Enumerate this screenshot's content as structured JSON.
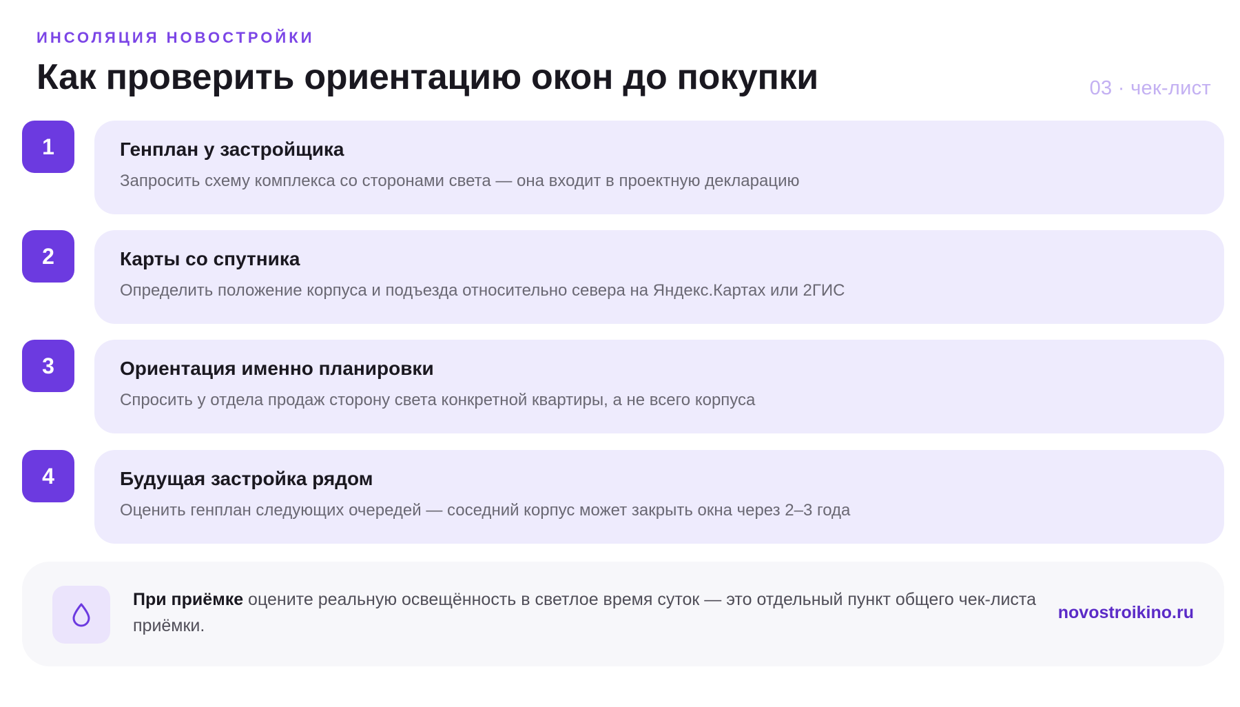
{
  "header": {
    "eyebrow": "ИНСОЛЯЦИЯ НОВОСТРОЙКИ",
    "title": "Как проверить ориентацию окон до покупки",
    "page_tag": "03 · чек-лист"
  },
  "steps": [
    {
      "number": "1",
      "title": "Генплан у застройщика",
      "description": "Запросить схему комплекса со сторонами света — она входит в проектную декларацию"
    },
    {
      "number": "2",
      "title": "Карты со спутника",
      "description": "Определить положение корпуса и подъезда относительно севера на Яндекс.Картах или 2ГИС"
    },
    {
      "number": "3",
      "title": "Ориентация именно планировки",
      "description": "Спросить у отдела продаж сторону света конкретной квартиры, а не всего корпуса"
    },
    {
      "number": "4",
      "title": "Будущая застройка рядом",
      "description": "Оценить генплан следующих очередей — соседний корпус может закрыть окна через 2–3 года"
    }
  ],
  "note": {
    "icon": "drop-icon",
    "lead": "При приёмке",
    "text": " оцените реальную освещённость в светлое время суток — это отдельный пункт общего чек-листа приёмки.",
    "link": "novostroikino.ru"
  },
  "colors": {
    "accent": "#6c3ae0",
    "eyebrow": "#7b45e6",
    "card_bg": "#eeebfd",
    "note_bg": "#f7f7fa",
    "page_tag": "#c3b0f2",
    "link": "#5b2bc7"
  }
}
